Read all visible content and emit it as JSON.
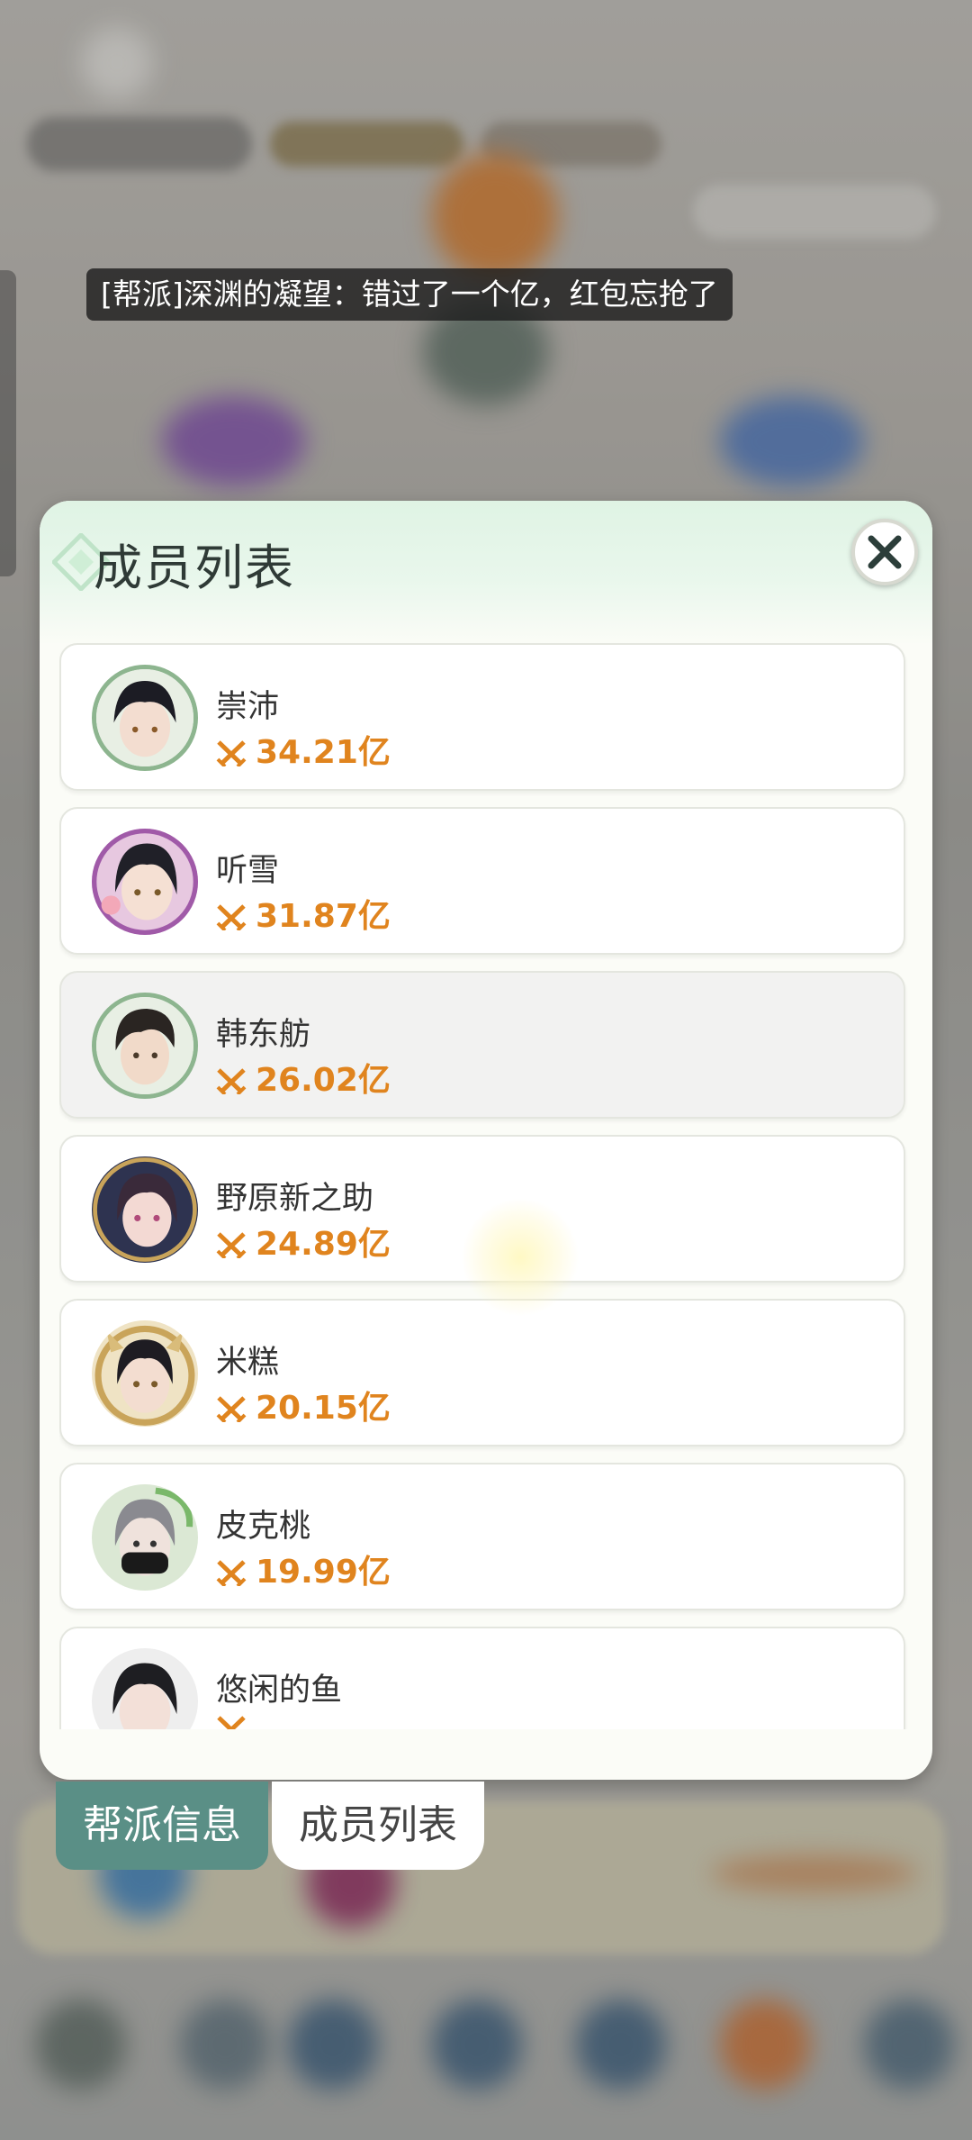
{
  "chat": {
    "message": "[帮派]深渊的凝望：错过了一个亿，红包忘抢了"
  },
  "modal": {
    "title": "成员列表",
    "close_icon": "close-icon"
  },
  "members": [
    {
      "name": "崇沛",
      "power": "34.21亿",
      "selected": false
    },
    {
      "name": "听雪",
      "power": "31.87亿",
      "selected": false
    },
    {
      "name": "韩东舫",
      "power": "26.02亿",
      "selected": true
    },
    {
      "name": "野原新之助",
      "power": "24.89亿",
      "selected": false
    },
    {
      "name": "米糕",
      "power": "20.15亿",
      "selected": false
    },
    {
      "name": "皮克桃",
      "power": "19.99亿",
      "selected": false
    },
    {
      "name": "悠闲的鱼",
      "power": "",
      "selected": false
    }
  ],
  "tabs": [
    {
      "label": "帮派信息",
      "active": false
    },
    {
      "label": "成员列表",
      "active": true
    }
  ],
  "colors": {
    "accent_green": "#5a8f86",
    "power_orange": "#e0841e"
  }
}
